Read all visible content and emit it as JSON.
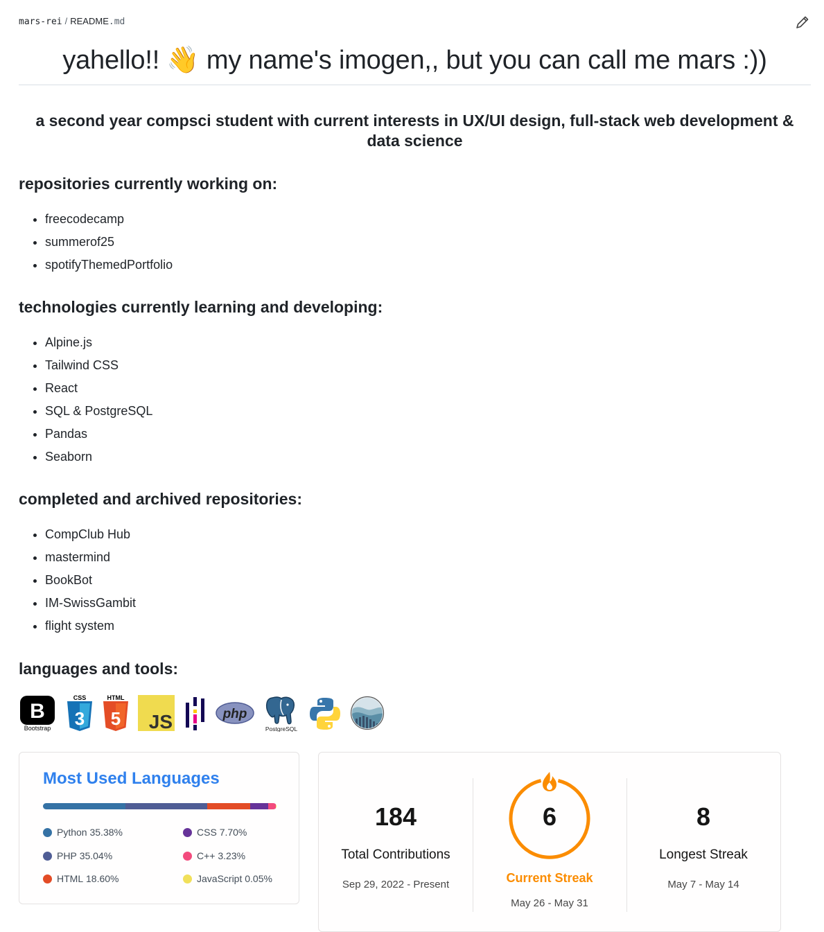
{
  "breadcrumb": {
    "owner": "mars-rei",
    "separator": "/",
    "file_name": "README",
    "file_ext": ".md"
  },
  "actions": {
    "edit_icon": "pencil-icon"
  },
  "title": "yahello!! 👋 my name's imogen,, but you can call me mars :))",
  "subtitle": "a second year compsci student with current interests in UX/UI design, full-stack web development & data science",
  "sections": {
    "working": {
      "heading": "repositories currently working on:",
      "items": [
        "freecodecamp",
        "summerof25",
        "spotifyThemedPortfolio"
      ]
    },
    "learning": {
      "heading": "technologies currently learning and developing:",
      "items": [
        "Alpine.js",
        "Tailwind CSS",
        "React",
        "SQL & PostgreSQL",
        "Pandas",
        "Seaborn"
      ]
    },
    "completed": {
      "heading": "completed and archived repositories:",
      "items": [
        "CompClub Hub",
        "mastermind",
        "BookBot",
        "IM-SwissGambit",
        "flight system"
      ]
    },
    "tools": {
      "heading": "languages and tools:",
      "logos": [
        {
          "icon": "bootstrap-icon",
          "caption": "Bootstrap"
        },
        {
          "icon": "css3-icon",
          "caption": "CSS"
        },
        {
          "icon": "html5-icon",
          "caption": "HTML"
        },
        {
          "icon": "javascript-icon",
          "caption": "JS"
        },
        {
          "icon": "pandas-icon",
          "caption": ""
        },
        {
          "icon": "php-icon",
          "caption": "php"
        },
        {
          "icon": "postgresql-icon",
          "caption": "PostgreSQL"
        },
        {
          "icon": "python-icon",
          "caption": ""
        },
        {
          "icon": "seaborn-icon",
          "caption": ""
        }
      ]
    }
  },
  "languages_card": {
    "title": "Most Used Languages",
    "languages": [
      {
        "name": "Python",
        "percent": "35.38%",
        "value": 35.38,
        "color": "#3572A5"
      },
      {
        "name": "PHP",
        "percent": "35.04%",
        "value": 35.04,
        "color": "#4F5D95"
      },
      {
        "name": "HTML",
        "percent": "18.60%",
        "value": 18.6,
        "color": "#e34c26"
      },
      {
        "name": "CSS",
        "percent": "7.70%",
        "value": 7.7,
        "color": "#663399"
      },
      {
        "name": "C++",
        "percent": "3.23%",
        "value": 3.23,
        "color": "#f34b7d"
      },
      {
        "name": "JavaScript",
        "percent": "0.05%",
        "value": 0.05,
        "color": "#f1e05a"
      }
    ]
  },
  "streak_card": {
    "total": {
      "value": "184",
      "label": "Total Contributions",
      "range": "Sep 29, 2022 - Present"
    },
    "current": {
      "value": "6",
      "label": "Current Streak",
      "range": "May 26 - May 31",
      "color": "#FB8C00"
    },
    "longest": {
      "value": "8",
      "label": "Longest Streak",
      "range": "May 7 - May 14"
    }
  }
}
